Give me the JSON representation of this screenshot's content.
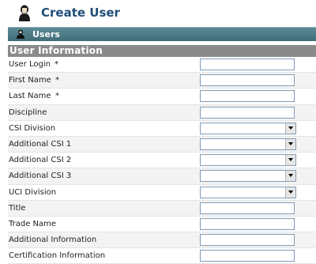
{
  "header": {
    "title": "Create User",
    "icon": "user-icon"
  },
  "tab": {
    "label": "Users",
    "icon": "user-icon"
  },
  "section": {
    "title": "User Information"
  },
  "fields": [
    {
      "label": "User Login",
      "required": "*",
      "type": "text",
      "value": ""
    },
    {
      "label": "First Name",
      "required": "*",
      "type": "text",
      "value": ""
    },
    {
      "label": "Last Name",
      "required": "*",
      "type": "text",
      "value": ""
    },
    {
      "label": "Discipline",
      "required": "",
      "type": "text",
      "value": ""
    },
    {
      "label": "CSI Division",
      "required": "",
      "type": "select",
      "value": ""
    },
    {
      "label": "Additional CSI 1",
      "required": "",
      "type": "select",
      "value": ""
    },
    {
      "label": "Additional CSI 2",
      "required": "",
      "type": "select",
      "value": ""
    },
    {
      "label": "Additional CSI 3",
      "required": "",
      "type": "select",
      "value": ""
    },
    {
      "label": "UCI Division",
      "required": "",
      "type": "select",
      "value": ""
    },
    {
      "label": "Title",
      "required": "",
      "type": "text",
      "value": ""
    },
    {
      "label": "Trade Name",
      "required": "",
      "type": "text",
      "value": ""
    },
    {
      "label": "Additional Information",
      "required": "",
      "type": "text",
      "value": ""
    },
    {
      "label": "Certification Information",
      "required": "",
      "type": "text",
      "value": ""
    }
  ],
  "colors": {
    "title": "#1f4e79",
    "tabbar": "#4f7c86",
    "section": "#8a8a8a"
  }
}
